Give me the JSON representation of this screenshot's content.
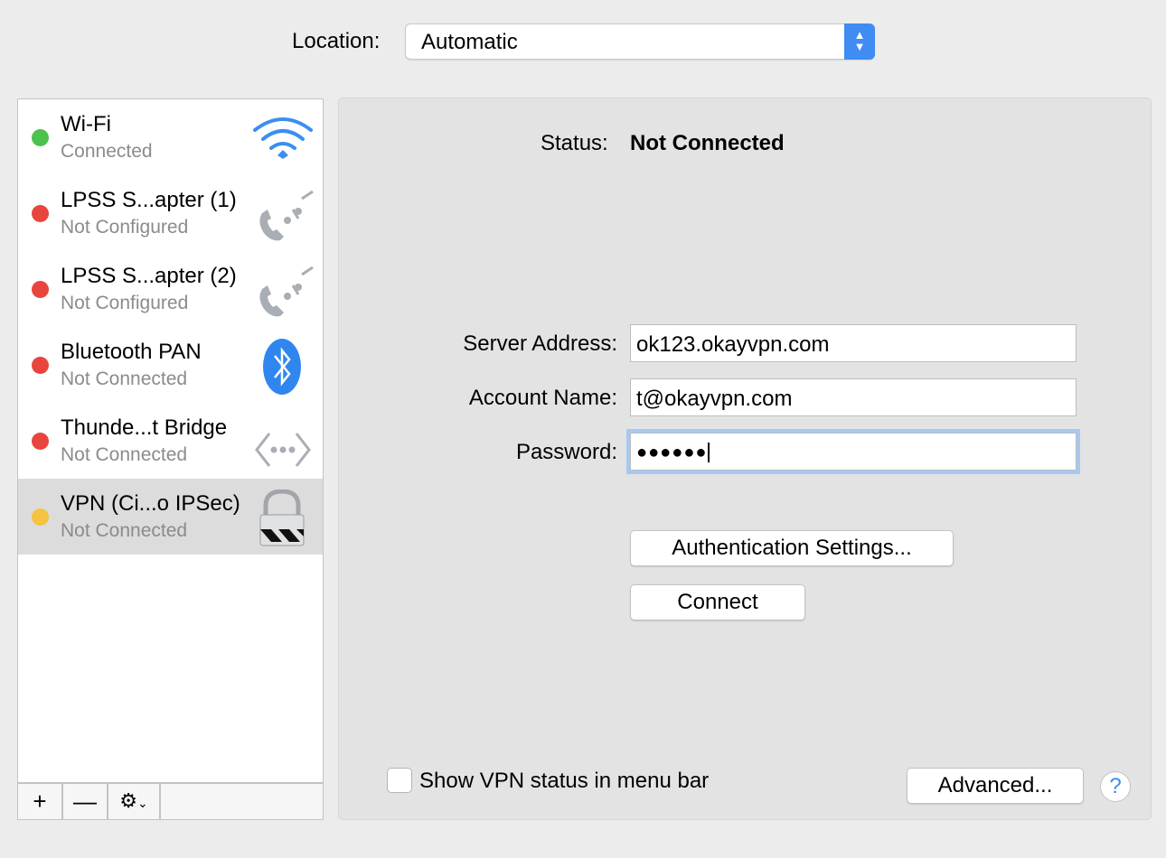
{
  "location": {
    "label": "Location:",
    "value": "Automatic"
  },
  "services": [
    {
      "name": "Wi-Fi",
      "status": "Connected",
      "color": "#4cc14b",
      "icon": "wifi-icon"
    },
    {
      "name": "LPSS S...apter (1)",
      "status": "Not Configured",
      "color": "#e9453f",
      "icon": "phone-modem-icon"
    },
    {
      "name": "LPSS S...apter (2)",
      "status": "Not Configured",
      "color": "#e9453f",
      "icon": "phone-modem-icon"
    },
    {
      "name": "Bluetooth PAN",
      "status": "Not Connected",
      "color": "#e9453f",
      "icon": "bluetooth-icon"
    },
    {
      "name": "Thunde...t Bridge",
      "status": "Not Connected",
      "color": "#e9453f",
      "icon": "thunderbolt-bridge-icon"
    },
    {
      "name": "VPN (Ci...o IPSec)",
      "status": "Not Connected",
      "color": "#f5c242",
      "icon": "vpn-lock-icon",
      "selected": true
    }
  ],
  "toolbar": {
    "add": "+",
    "remove": "—"
  },
  "detail": {
    "status_label": "Status:",
    "status_value": "Not Connected",
    "server_label": "Server Address:",
    "server_value": "ok123.okayvpn.com",
    "account_label": "Account Name:",
    "account_value": "t@okayvpn.com",
    "password_label": "Password:",
    "password_value": "●●●●●●",
    "auth_button": "Authentication Settings...",
    "connect_button": "Connect",
    "menu_bar_checkbox": "Show VPN status in menu bar",
    "menu_bar_checked": false,
    "advanced_button": "Advanced...",
    "help": "?"
  }
}
